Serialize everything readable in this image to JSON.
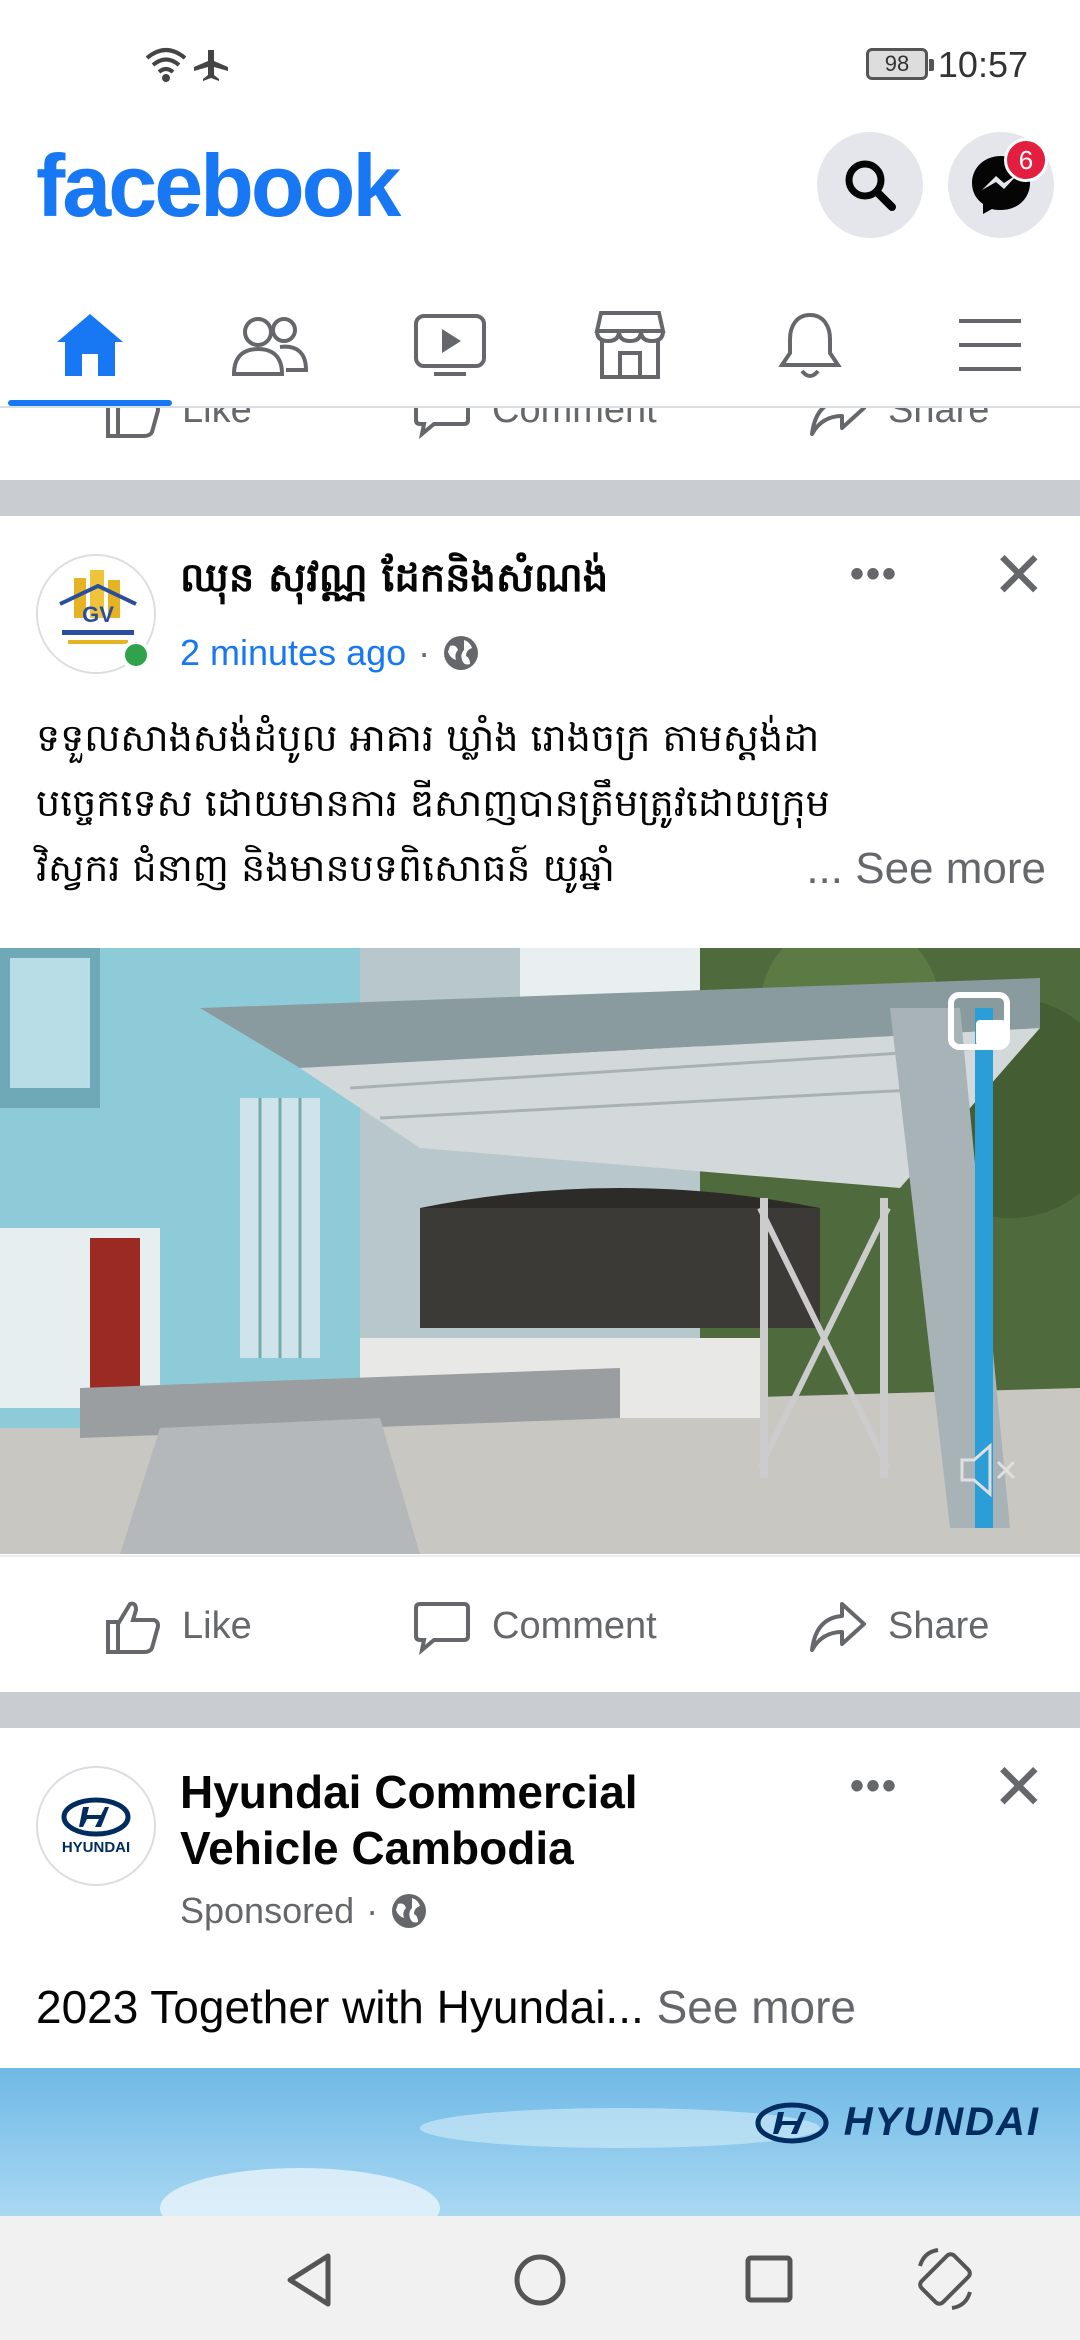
{
  "status_bar": {
    "time": "10:57",
    "battery": "98"
  },
  "header": {
    "logo": "facebook",
    "messenger_badge": "6"
  },
  "nav": {
    "items": [
      "home-icon",
      "friends-icon",
      "watch-icon",
      "marketplace-icon",
      "notifications-icon",
      "menu-icon"
    ]
  },
  "prev_post_actions": {
    "like": "Like",
    "comment": "Comment",
    "share": "Share"
  },
  "post1": {
    "author": "ឈុន សុវណ្ណ ដែកនិងសំណង់",
    "time": "2 minutes ago",
    "separator": "·",
    "text_line1": "ទទួលសាងសង់ដំបូល អាគារ ឃ្លាំង រោងចក្រ តាមស្តង់ដា",
    "text_line2": "បច្ចេកទេស ដោយមានការ ឌីសាញបានត្រឹមត្រូវដោយក្រុម",
    "text_line3": "វិស្វករ ជំនាញ និងមានបទពិសោធន៍ យូឆ្នាំ",
    "ellipsis": "...",
    "see_more": "See more",
    "avatar_text": "GV",
    "like": "Like",
    "comment": "Comment",
    "share": "Share"
  },
  "post2": {
    "author_line1": "Hyundai Commercial",
    "author_line2": "Vehicle Cambodia",
    "sponsored": "Sponsored",
    "separator": "·",
    "text": "2023 Together with Hyundai...",
    "see_more": "See more",
    "avatar_text": "HYUNDAI",
    "banner_brand": "HYUNDAI"
  },
  "colors": {
    "accent": "#1877f2",
    "badge": "#e41e3f",
    "online": "#31a24c"
  }
}
